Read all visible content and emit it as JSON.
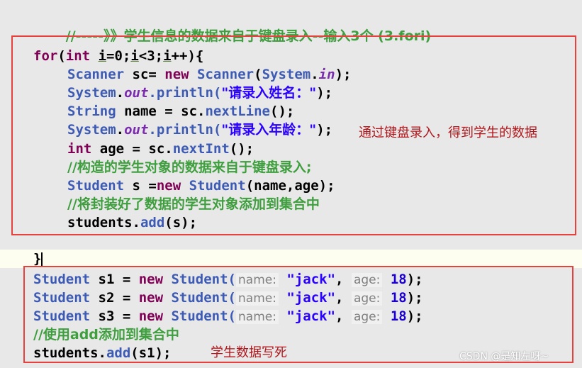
{
  "header_comment": "//-----》》学生信息的数据来自于键盘录入--输入3个 (3.fori)",
  "loop": {
    "kw_for": "for",
    "kw_int": "int",
    "var_i": "i",
    "init": "=0;",
    "cond_i": "i",
    "cond": "<3;",
    "inc_i": "i",
    "inc": "++){"
  },
  "lines": {
    "l1_type": "Scanner",
    "l1_rest": " sc= ",
    "l1_new": "new",
    "l1_type2": " Scanner",
    "l1_open": "(",
    "l1_sys": "System",
    "l1_dot": ".",
    "l1_in": "in",
    "l1_close": ");",
    "l2_sys": "System",
    "l2_dot": ".",
    "l2_out": "out",
    "l2_println": ".println(",
    "l2_str": "\"请录入姓名：\"",
    "l2_close": ");",
    "l3_type": "String",
    "l3_rest": " name = sc.",
    "l3_method": "nextLine",
    "l3_close": "();",
    "l4_sys": "System",
    "l4_dot": ".",
    "l4_out": "out",
    "l4_println": ".println(",
    "l4_str": "\"请录入年龄：\"",
    "l4_close": ");",
    "l5_kw": "int",
    "l5_rest": " age = sc.",
    "l5_method": "nextInt",
    "l5_close": "();",
    "l6_comment": "//构造的学生对象的数据来自于键盘录入;",
    "l7_type": "Student",
    "l7_rest": " s =",
    "l7_new": "new",
    "l7_type2": " Student",
    "l7_args": "(name,age);",
    "l8_comment": "//将封装好了数据的学生对象添加到集合中",
    "l9_pre": "students.",
    "l9_method": "add",
    "l9_args": "(s);"
  },
  "closing_brace": "}",
  "hardcoded": [
    {
      "type": "Student",
      "var": " s1 = ",
      "new": "new",
      "type2": " Student(",
      "hint_name": "name:",
      "str": "\"jack\"",
      "comma": ",",
      "hint_age": "age:",
      "num": "18",
      "close": ");"
    },
    {
      "type": "Student",
      "var": " s2 = ",
      "new": "new",
      "type2": " Student(",
      "hint_name": "name:",
      "str": "\"jack\"",
      "comma": ",",
      "hint_age": "age:",
      "num": "18",
      "close": ");"
    },
    {
      "type": "Student",
      "var": " s3 = ",
      "new": "new",
      "type2": " Student(",
      "hint_name": "name:",
      "str": "\"jack\"",
      "comma": ",",
      "hint_age": "age:",
      "num": "18",
      "close": ");"
    }
  ],
  "comment_add": "//使用add添加到集合中",
  "last_line": {
    "pre": "students.",
    "method": "add",
    "args": "(s1);"
  },
  "annotations": {
    "keyboard_note": "通过键盘录入，得到学生的数据",
    "hardcode_note": "学生数据写死"
  },
  "watermark": "CSDN @是知左呀~",
  "colors": {
    "box_border": "#e8403c",
    "note_text": "#b0161b",
    "keyword": "#7f0055",
    "string": "#2a00ff"
  }
}
